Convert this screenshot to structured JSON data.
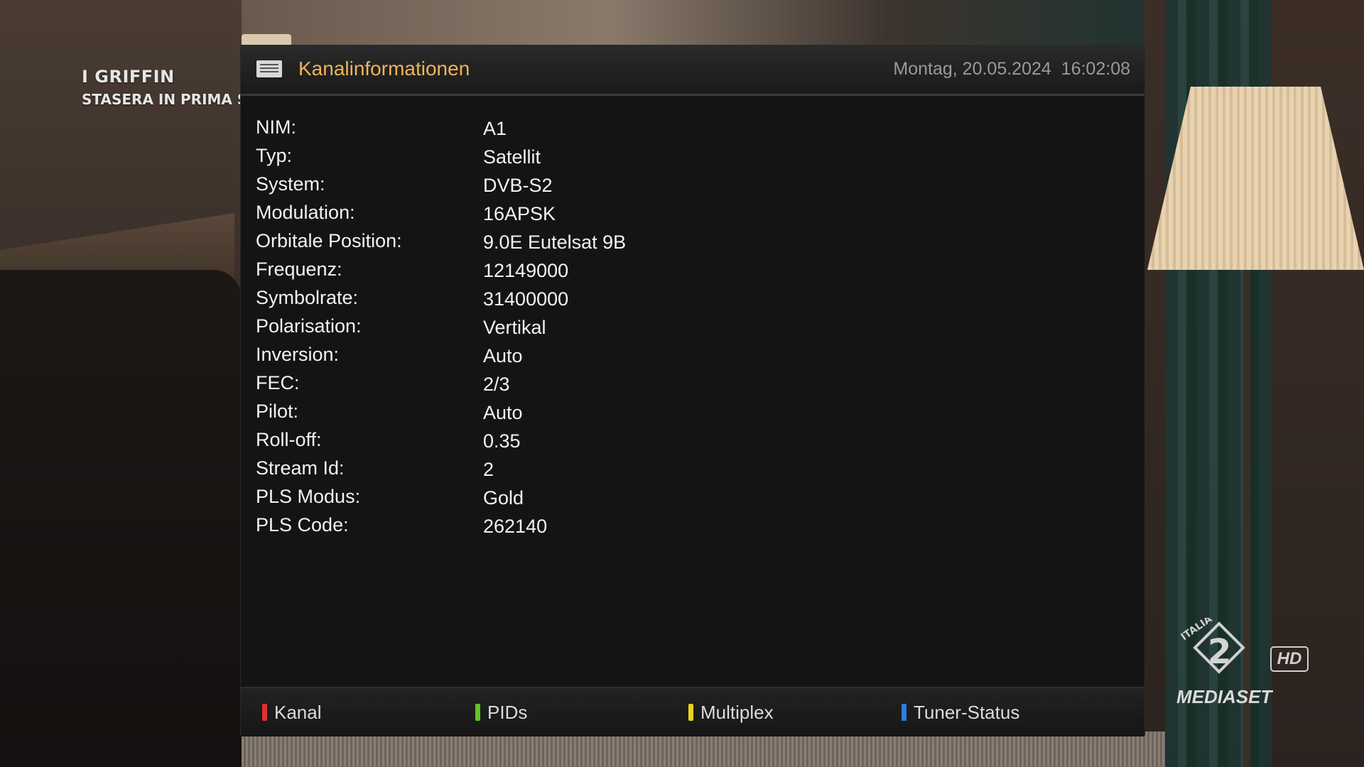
{
  "broadcast": {
    "overlay_title": "I GRIFFIN",
    "overlay_subtitle": "STASERA IN PRIMA S",
    "logo_brand": "MEDIASET",
    "logo_hd": "HD"
  },
  "header": {
    "title": "Kanalinformationen",
    "datetime": "Montag, 20.05.2024  16:02:08",
    "icon": "channel-info-icon"
  },
  "info": [
    {
      "label": "NIM:",
      "value": "A1"
    },
    {
      "label": "Typ:",
      "value": "Satellit"
    },
    {
      "label": "System:",
      "value": "DVB-S2"
    },
    {
      "label": "Modulation:",
      "value": "16APSK"
    },
    {
      "label": "Orbitale Position:",
      "value": "9.0E Eutelsat 9B"
    },
    {
      "label": "Frequenz:",
      "value": "12149000"
    },
    {
      "label": "Symbolrate:",
      "value": "31400000"
    },
    {
      "label": "Polarisation:",
      "value": "Vertikal"
    },
    {
      "label": "Inversion:",
      "value": "Auto"
    },
    {
      "label": "FEC:",
      "value": "2/3"
    },
    {
      "label": "Pilot:",
      "value": "Auto"
    },
    {
      "label": "Roll-off:",
      "value": "0.35"
    },
    {
      "label": "Stream Id:",
      "value": "2"
    },
    {
      "label": "PLS Modus:",
      "value": "Gold"
    },
    {
      "label": "PLS Code:",
      "value": "262140"
    }
  ],
  "footer": {
    "buttons": [
      {
        "label": "Kanal",
        "color": "#e0302a"
      },
      {
        "label": "PIDs",
        "color": "#5fc42a"
      },
      {
        "label": "Multiplex",
        "color": "#e8d21c"
      },
      {
        "label": "Tuner-Status",
        "color": "#2a7fe0"
      }
    ]
  },
  "colors": {
    "accent": "#f0b35a",
    "panel": "#141414",
    "text": "#f2f2f2",
    "muted": "#9a9a9a"
  }
}
